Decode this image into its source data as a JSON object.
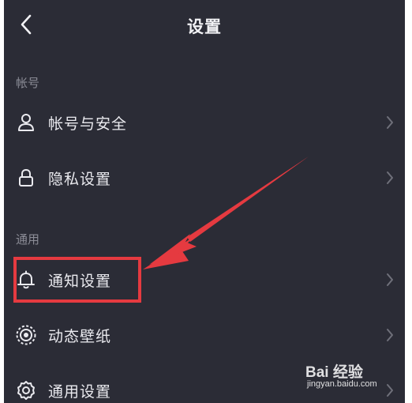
{
  "header": {
    "title": "设置",
    "back_icon": "chevron-left-icon"
  },
  "sections": [
    {
      "label": "帐号",
      "items": [
        {
          "label": "帐号与安全",
          "icon": "user-icon"
        },
        {
          "label": "隐私设置",
          "icon": "lock-icon"
        }
      ]
    },
    {
      "label": "通用",
      "items": [
        {
          "label": "通知设置",
          "icon": "bell-icon",
          "highlighted": true
        },
        {
          "label": "动态壁纸",
          "icon": "live-wallpaper-icon"
        },
        {
          "label": "通用设置",
          "icon": "gear-icon"
        }
      ]
    }
  ],
  "annotation": {
    "box_color": "#e53a40",
    "arrow_color": "#e53a40"
  },
  "watermark": {
    "brand": "Bai 经验",
    "url": "jingyan.baidu.com"
  },
  "colors": {
    "background": "#2b2c36",
    "text": "#eaeaef",
    "section_label": "#8b8c96",
    "chevron": "#6f707a"
  }
}
